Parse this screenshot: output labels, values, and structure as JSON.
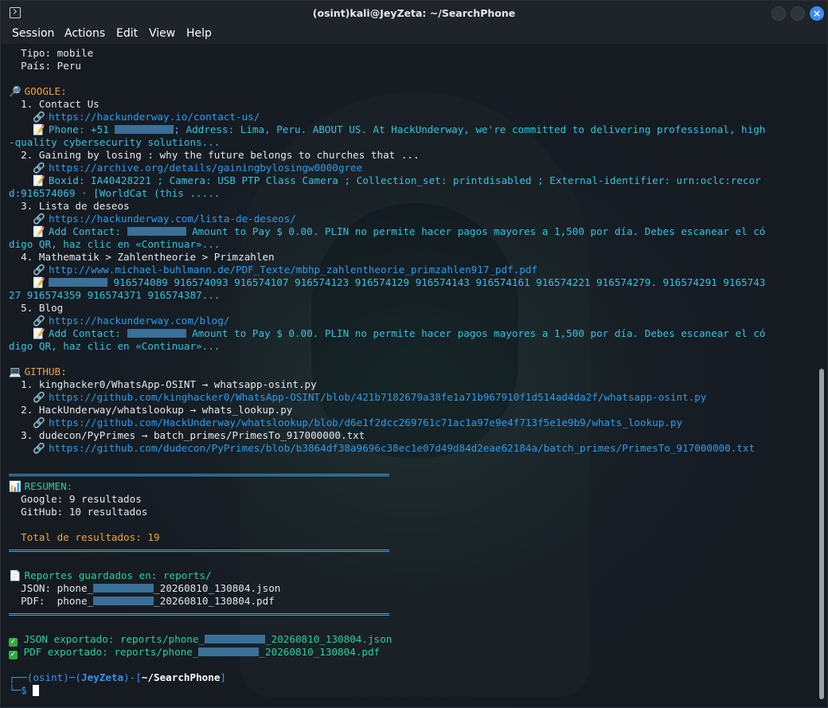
{
  "window": {
    "title": "(osint)kali@JeyZeta: ~/SearchPhone",
    "close_glyph": "×"
  },
  "menu": [
    "Session",
    "Actions",
    "Edit",
    "View",
    "Help"
  ],
  "colors": {
    "accent": "#3d8cf5",
    "cyan": "#36c2e0",
    "orange": "#f0a43a",
    "green": "#2ccf9a",
    "link": "#2a9cf0"
  },
  "icons": {
    "search": "🔎",
    "link": "🔗",
    "note": "📝",
    "laptop": "💻",
    "chart": "📊",
    "document": "📄",
    "check": "✓"
  },
  "info": {
    "tipo": "  Tipo: mobile",
    "pais": "  País: Peru"
  },
  "google": {
    "header": " GOOGLE:",
    "results": [
      {
        "title": "  1. Contact Us",
        "url": "https://hackunderway.io/contact-us/",
        "snippet_a": " Phone: +51 ",
        "snippet_b": "; Address: Lima, Peru. ABOUT US. At HackUnderway, we're committed to delivering professional, high",
        "snippet_c": "-quality cybersecurity solutions..."
      },
      {
        "title": "  2. Gaining by losing : why the future belongs to churches that ...",
        "url": "https://archive.org/details/gainingbylosingw0000gree",
        "snippet_a": " Boxid: IA40428221 ; Camera: USB PTP Class Camera ; Collection_set: printdisabled ; External-identifier: urn:oclc:recor",
        "snippet_c": "d:916574069 · [WorldCat (this ....."
      },
      {
        "title": "  3. Lista de deseos",
        "url": "https://hackunderway.com/lista-de-deseos/",
        "snippet_a": " Add Contact: ",
        "snippet_b": " Amount to Pay $ 0.00. PLIN no permite hacer pagos mayores a 1,500 por día. Debes escanear el có",
        "snippet_c": "digo QR, haz clic en «Continuar»..."
      },
      {
        "title": "  4. Mathematik > Zahlentheorie > Primzahlen",
        "url": "http://www.michael-buhlmann.de/PDF_Texte/mbhp_zahlentheorie_primzahlen917_pdf.pdf",
        "snippet_b": " 916574089 916574093 916574107 916574123 916574129 916574143 916574161 916574221 916574279. 916574291 9165743",
        "snippet_c": "27 916574359 916574371 916574387..."
      },
      {
        "title": "  5. Blog",
        "url": "https://hackunderway.com/blog/",
        "snippet_a": " Add Contact: ",
        "snippet_b": " Amount to Pay $ 0.00. PLIN no permite hacer pagos mayores a 1,500 por día. Debes escanear el có",
        "snippet_c": "digo QR, haz clic en «Continuar»..."
      }
    ]
  },
  "github": {
    "header": " GITHUB:",
    "results": [
      {
        "title": "  1. kinghacker0/WhatsApp-OSINT → whatsapp-osint.py",
        "url": "https://github.com/kinghacker0/WhatsApp-OSINT/blob/421b7182679a38fe1a71b967910f1d514ad4da2f/whatsapp-osint.py"
      },
      {
        "title": "  2. HackUnderway/whatslookup → whats_lookup.py",
        "url": "https://github.com/HackUnderway/whatslookup/blob/d6e1f2dcc269761c71ac1a97e9e4f713f5e1e9b9/whats_lookup.py"
      },
      {
        "title": "  3. dudecon/PyPrimes → batch_primes/PrimesTo_917000000.txt",
        "url": "https://github.com/dudecon/PyPrimes/blob/b3864df38a9696c38ec1e07d49d84d2eae62184a/batch_primes/PrimesTo_917000000.txt"
      }
    ]
  },
  "summary": {
    "header": " RESUMEN:",
    "google": "  Google: 9 resultados",
    "github": "  GitHub: 10 resultados",
    "total": "  Total de resultados: 19"
  },
  "reports": {
    "header": " Reportes guardados en: reports/",
    "json_a": "  JSON: phone_",
    "json_b": "_20260810_130804.json",
    "pdf_a": "  PDF:  phone_",
    "pdf_b": "_20260810_130804.pdf"
  },
  "exports": {
    "json_a": " JSON exportado: reports/phone_",
    "json_b": "_20260810_130804.json",
    "pdf_a": " PDF exportado: reports/phone_",
    "pdf_b": "_20260810_130804.pdf"
  },
  "prompt": {
    "line1_start": "┌──(osint)─(",
    "user": "JeyZeta",
    "line1_mid": ")-[",
    "path": "~/SearchPhone",
    "line1_end": "]",
    "line2": "└─$ "
  }
}
